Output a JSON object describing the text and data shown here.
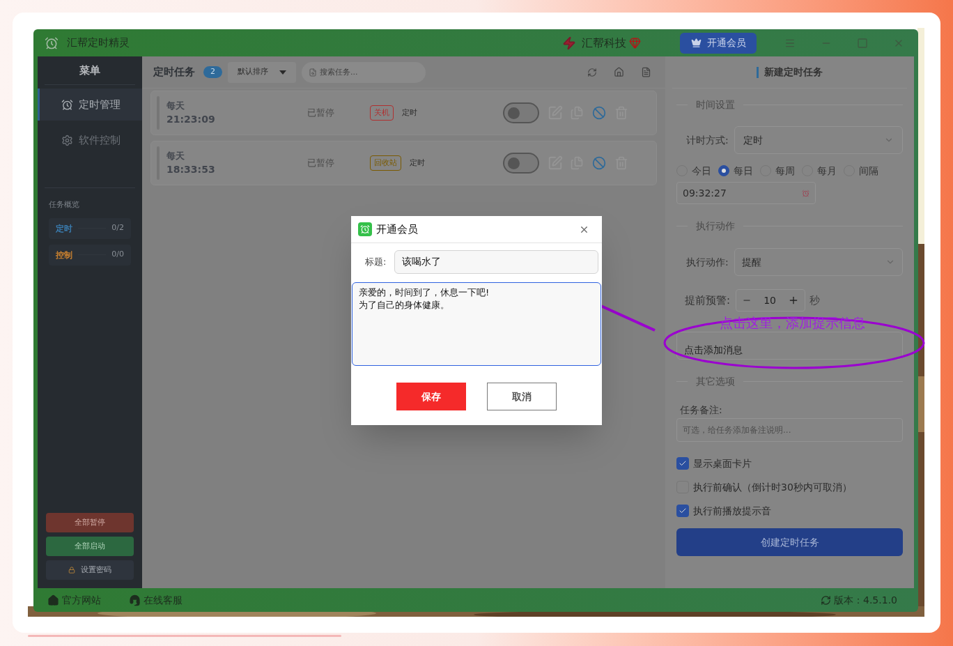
{
  "window": {
    "title": "汇帮定时精灵",
    "brand": "汇帮科技",
    "vip_button": "开通会员"
  },
  "sidebar": {
    "title": "菜单",
    "items": [
      {
        "label": "定时管理",
        "selected": true
      },
      {
        "label": "软件控制",
        "selected": false
      }
    ],
    "overview": {
      "title": "任务概览",
      "stats": [
        {
          "label": "定时",
          "count": "0/2",
          "color": "#3a7cb0"
        },
        {
          "label": "控制",
          "count": "0/0",
          "color": "#c8802f"
        }
      ]
    },
    "buttons": [
      {
        "label": "全部暂停",
        "kind": "danger"
      },
      {
        "label": "全部启动",
        "kind": "success"
      },
      {
        "label": "设置密码",
        "kind": "lock"
      }
    ]
  },
  "task_list": {
    "title": "定时任务",
    "count": "2",
    "sort": "默认排序",
    "search_placeholder": "搜索任务...",
    "tasks": [
      {
        "repeat": "每天",
        "time": "21:23:09",
        "status": "已暂停",
        "action": "关机",
        "color": "#b03030",
        "type": "定时",
        "on": false
      },
      {
        "repeat": "每天",
        "time": "18:33:53",
        "status": "已暂停",
        "action": "回收站",
        "color": "#7a5a00",
        "type": "定时",
        "on": false
      }
    ]
  },
  "form": {
    "title": "新建定时任务",
    "time_section": "时间设置",
    "timing_label": "计时方式:",
    "timing_value": "定时",
    "frequencies": [
      {
        "label": "今日",
        "selected": false
      },
      {
        "label": "每日",
        "selected": true
      },
      {
        "label": "每周",
        "selected": false
      },
      {
        "label": "每月",
        "selected": false
      },
      {
        "label": "间隔",
        "selected": false
      }
    ],
    "time_value": "09:32:27",
    "action_section": "执行动作",
    "action_label": "执行动作:",
    "action_value": "提醒",
    "warning_label": "提前预警:",
    "warning_value": "10",
    "warning_unit": "秒",
    "message_button": "点击添加消息",
    "other_section": "其它选项",
    "note_label": "任务备注:",
    "note_placeholder": "可选，给任务添加备注说明...",
    "options": [
      {
        "label": "显示桌面卡片",
        "checked": true
      },
      {
        "label": "执行前确认（倒计时30秒内可取消）",
        "checked": false
      },
      {
        "label": "执行前播放提示音",
        "checked": true
      }
    ],
    "submit": "创建定时任务"
  },
  "footer": {
    "links": [
      {
        "label": "官方网站"
      },
      {
        "label": "在线客服"
      }
    ],
    "version": "版本：4.5.1.0"
  },
  "dialog": {
    "title": "开通会员",
    "title_label": "标题:",
    "title_value": "该喝水了",
    "message_lines": [
      "亲爱的，时间到了，休息一下吧!",
      "为了自己的身体健康。"
    ],
    "save": "保存",
    "cancel": "取消"
  },
  "annotation": {
    "text": "点击这里，添加提示信息"
  }
}
